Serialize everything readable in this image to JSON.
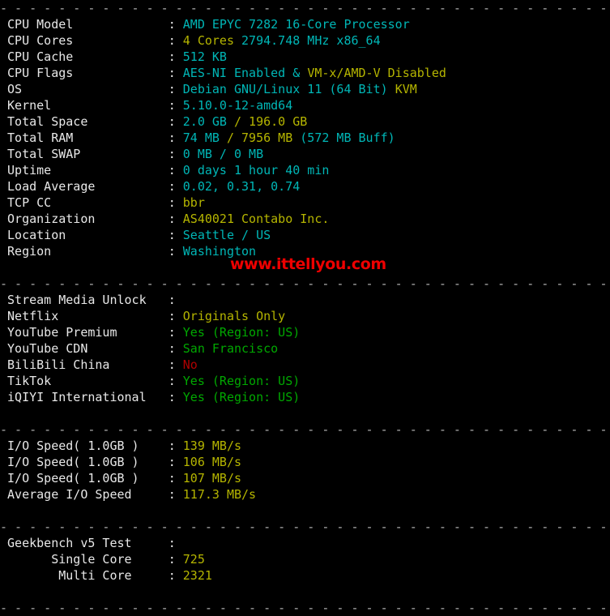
{
  "terminal": {
    "separator": "- - - - - - - - - - - - - - - - - - - - - - - - - - - - - - - - - - - - - - - - - - - - - - - - - -",
    "watermark": "www.ittellyou.com",
    "colors": {
      "background": "#000000",
      "label": "#e8e8e8",
      "cyan": "#00b6b6",
      "yellow": "#b5b500",
      "green": "#00a800",
      "red": "#b00000",
      "watermark": "#ee0000"
    },
    "sections": [
      {
        "name": "system-info",
        "rows": [
          {
            "label": "CPU Model",
            "segments": [
              {
                "text": "AMD EPYC 7282 16-Core Processor",
                "color": "cyan"
              }
            ]
          },
          {
            "label": "CPU Cores",
            "segments": [
              {
                "text": "4 Cores ",
                "color": "yellow"
              },
              {
                "text": "2794.748 MHz x86_64",
                "color": "cyan"
              }
            ]
          },
          {
            "label": "CPU Cache",
            "segments": [
              {
                "text": "512 KB",
                "color": "cyan"
              }
            ]
          },
          {
            "label": "CPU Flags",
            "segments": [
              {
                "text": "AES-NI Enabled & ",
                "color": "cyan"
              },
              {
                "text": "VM-x/AMD-V Disabled",
                "color": "yellow"
              }
            ]
          },
          {
            "label": "OS",
            "segments": [
              {
                "text": "Debian GNU/Linux 11 (64 Bit) ",
                "color": "cyan"
              },
              {
                "text": "KVM",
                "color": "yellow"
              }
            ]
          },
          {
            "label": "Kernel",
            "segments": [
              {
                "text": "5.10.0-12-amd64",
                "color": "cyan"
              }
            ]
          },
          {
            "label": "Total Space",
            "segments": [
              {
                "text": "2.0 GB ",
                "color": "cyan"
              },
              {
                "text": "/ 196.0 GB",
                "color": "yellow"
              }
            ]
          },
          {
            "label": "Total RAM",
            "segments": [
              {
                "text": "74 MB ",
                "color": "cyan"
              },
              {
                "text": "/ 7956 MB ",
                "color": "yellow"
              },
              {
                "text": "(572 MB Buff)",
                "color": "cyan"
              }
            ]
          },
          {
            "label": "Total SWAP",
            "segments": [
              {
                "text": "0 MB / 0 MB",
                "color": "cyan"
              }
            ]
          },
          {
            "label": "Uptime",
            "segments": [
              {
                "text": "0 days 1 hour 40 min",
                "color": "cyan"
              }
            ]
          },
          {
            "label": "Load Average",
            "segments": [
              {
                "text": "0.02, 0.31, 0.74",
                "color": "cyan"
              }
            ]
          },
          {
            "label": "TCP CC",
            "segments": [
              {
                "text": "bbr",
                "color": "yellow"
              }
            ]
          },
          {
            "label": "Organization",
            "segments": [
              {
                "text": "AS40021 Contabo Inc.",
                "color": "yellow"
              }
            ]
          },
          {
            "label": "Location",
            "segments": [
              {
                "text": "Seattle / US",
                "color": "cyan"
              }
            ]
          },
          {
            "label": "Region",
            "segments": [
              {
                "text": "Washington",
                "color": "cyan"
              }
            ]
          }
        ]
      },
      {
        "name": "stream-media-unlock",
        "rows": [
          {
            "label": "Stream Media Unlock",
            "segments": []
          },
          {
            "label": "Netflix",
            "segments": [
              {
                "text": "Originals Only",
                "color": "yellow"
              }
            ]
          },
          {
            "label": "YouTube Premium",
            "segments": [
              {
                "text": "Yes (Region: US)",
                "color": "green"
              }
            ]
          },
          {
            "label": "YouTube CDN",
            "segments": [
              {
                "text": "San Francisco",
                "color": "green"
              }
            ]
          },
          {
            "label": "BiliBili China",
            "segments": [
              {
                "text": "No",
                "color": "red"
              }
            ]
          },
          {
            "label": "TikTok",
            "segments": [
              {
                "text": "Yes (Region: US)",
                "color": "green"
              }
            ]
          },
          {
            "label": "iQIYI International",
            "segments": [
              {
                "text": "Yes (Region: US)",
                "color": "green"
              }
            ]
          }
        ]
      },
      {
        "name": "io-speed",
        "rows": [
          {
            "label": "I/O Speed( 1.0GB )",
            "segments": [
              {
                "text": "139 MB/s",
                "color": "yellow"
              }
            ]
          },
          {
            "label": "I/O Speed( 1.0GB )",
            "segments": [
              {
                "text": "106 MB/s",
                "color": "yellow"
              }
            ]
          },
          {
            "label": "I/O Speed( 1.0GB )",
            "segments": [
              {
                "text": "107 MB/s",
                "color": "yellow"
              }
            ]
          },
          {
            "label": "Average I/O Speed",
            "segments": [
              {
                "text": "117.3 MB/s",
                "color": "yellow"
              }
            ]
          }
        ]
      },
      {
        "name": "geekbench",
        "rows": [
          {
            "label": "Geekbench v5 Test",
            "segments": []
          },
          {
            "label": "      Single Core",
            "segments": [
              {
                "text": "725",
                "color": "yellow"
              }
            ]
          },
          {
            "label": "       Multi Core",
            "segments": [
              {
                "text": "2321",
                "color": "yellow"
              }
            ]
          }
        ]
      }
    ]
  }
}
